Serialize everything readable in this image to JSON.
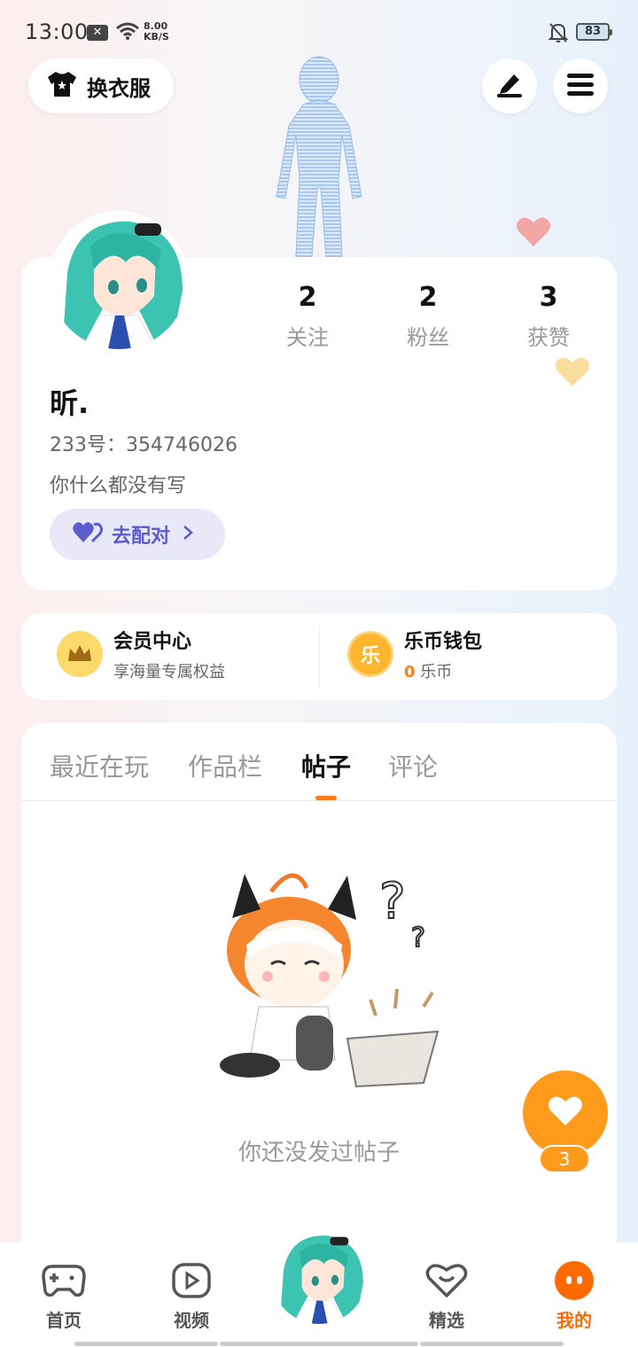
{
  "status_bar": {
    "time": "13:00",
    "speed_value": "8.00",
    "speed_unit": "KB/S",
    "battery": "83"
  },
  "header": {
    "outfit_label": "换衣服"
  },
  "profile": {
    "following_count": "2",
    "following_label": "关注",
    "followers_count": "2",
    "followers_label": "粉丝",
    "likes_count": "3",
    "likes_label": "获赞",
    "username": "昕.",
    "uid": "233号：354746026",
    "bio": "你什么都没有写",
    "match_label": "去配对"
  },
  "member": {
    "vip_title": "会员中心",
    "vip_sub": "享海量专属权益",
    "coin_icon_text": "乐",
    "wallet_title": "乐币钱包",
    "wallet_amount": "0",
    "wallet_unit": "乐币"
  },
  "tabs": [
    {
      "label": "最近在玩"
    },
    {
      "label": "作品栏"
    },
    {
      "label": "帖子"
    },
    {
      "label": "评论"
    }
  ],
  "empty_text": "你还没发过帖子",
  "like_fab_count": "3",
  "bottom_nav": {
    "home": "首页",
    "video": "视频",
    "featured": "精选",
    "mine": "我的"
  },
  "colors": {
    "accent": "#ff7a1a",
    "match_accent": "#5c5ccc",
    "fab": "#ff9a1a"
  }
}
